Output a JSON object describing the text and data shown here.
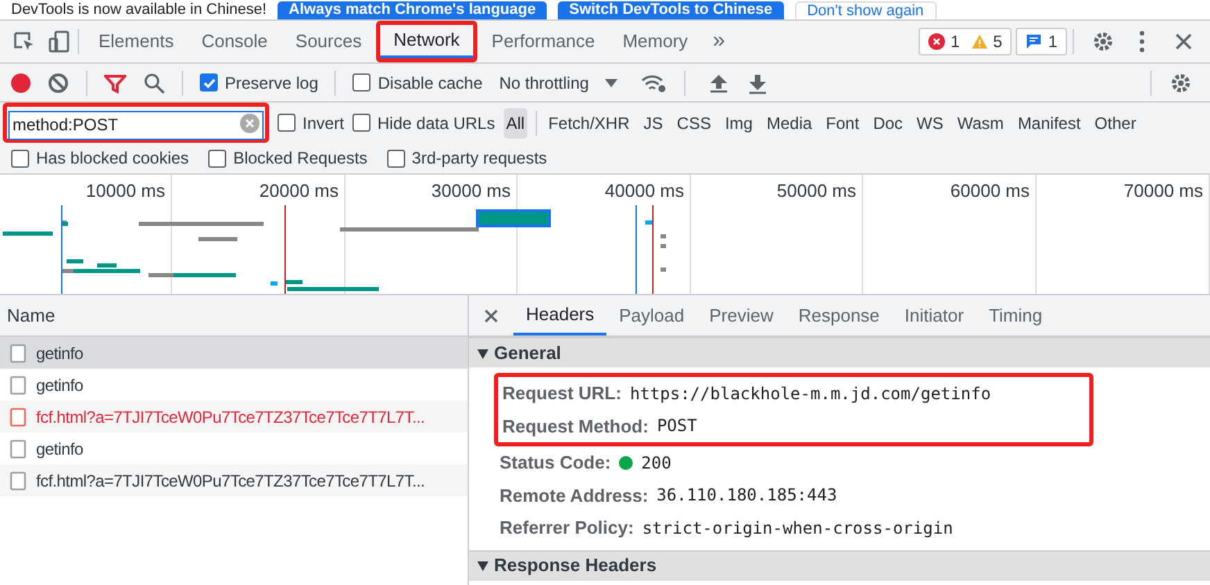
{
  "banner": {
    "text": "DevTools is now available in Chinese!",
    "buttons": [
      "Always match Chrome's language",
      "Switch DevTools to Chinese"
    ],
    "dismiss": "Don't show again"
  },
  "tabs": [
    {
      "label": "Elements",
      "selected": false,
      "highlighted": false
    },
    {
      "label": "Console",
      "selected": false,
      "highlighted": false
    },
    {
      "label": "Sources",
      "selected": false,
      "highlighted": false
    },
    {
      "label": "Network",
      "selected": true,
      "highlighted": true
    },
    {
      "label": "Performance",
      "selected": false,
      "highlighted": false
    },
    {
      "label": "Memory",
      "selected": false,
      "highlighted": false
    }
  ],
  "overflow": "»",
  "issues": {
    "errors": "1",
    "warnings": "5",
    "messages": "1"
  },
  "toolbar": {
    "recording": true,
    "preserve_log": {
      "label": "Preserve log",
      "checked": true
    },
    "disable_cache": {
      "label": "Disable cache",
      "checked": false
    },
    "throttling": "No throttling"
  },
  "filter": {
    "value": "method:POST",
    "highlighted": true,
    "invert": {
      "label": "Invert",
      "checked": false
    },
    "hide_data_urls": {
      "label": "Hide data URLs",
      "checked": false
    },
    "types": [
      {
        "label": "All",
        "selected": true
      },
      {
        "label": "Fetch/XHR",
        "selected": false
      },
      {
        "label": "JS",
        "selected": false
      },
      {
        "label": "CSS",
        "selected": false
      },
      {
        "label": "Img",
        "selected": false
      },
      {
        "label": "Media",
        "selected": false
      },
      {
        "label": "Font",
        "selected": false
      },
      {
        "label": "Doc",
        "selected": false
      },
      {
        "label": "WS",
        "selected": false
      },
      {
        "label": "Wasm",
        "selected": false
      },
      {
        "label": "Manifest",
        "selected": false
      },
      {
        "label": "Other",
        "selected": false
      }
    ]
  },
  "extra_filters": [
    {
      "label": "Has blocked cookies",
      "checked": false
    },
    {
      "label": "Blocked Requests",
      "checked": false
    },
    {
      "label": "3rd-party requests",
      "checked": false
    }
  ],
  "timeline": {
    "ticks": [
      "10000 ms",
      "20000 ms",
      "30000 ms",
      "40000 ms",
      "50000 ms",
      "60000 ms",
      "70000 ms"
    ]
  },
  "requests": {
    "column": "Name",
    "rows": [
      {
        "name": "getinfo",
        "selected": true,
        "failed": false
      },
      {
        "name": "getinfo",
        "selected": false,
        "failed": false
      },
      {
        "name": "fcf.html?a=7TJI7TceW0Pu7Tce7TZ37Tce7Tce7T7L7T...",
        "selected": false,
        "failed": true
      },
      {
        "name": "getinfo",
        "selected": false,
        "failed": false
      },
      {
        "name": "fcf.html?a=7TJI7TceW0Pu7Tce7TZ37Tce7Tce7T7L7T...",
        "selected": false,
        "failed": false
      }
    ]
  },
  "details": {
    "tabs": [
      {
        "label": "Headers",
        "selected": true
      },
      {
        "label": "Payload",
        "selected": false
      },
      {
        "label": "Preview",
        "selected": false
      },
      {
        "label": "Response",
        "selected": false
      },
      {
        "label": "Initiator",
        "selected": false
      },
      {
        "label": "Timing",
        "selected": false
      }
    ],
    "sections": [
      {
        "title": "General",
        "expanded": true,
        "fields": [
          {
            "kind": "plain",
            "label": "Request URL:",
            "value": "https://blackhole-m.m.jd.com/getinfo",
            "highlighted": true
          },
          {
            "kind": "plain",
            "label": "Request Method:",
            "value": "POST",
            "highlighted": true
          },
          {
            "kind": "status",
            "label": "Status Code:",
            "value": "200",
            "highlighted": false
          },
          {
            "kind": "plain",
            "label": "Remote Address:",
            "value": "36.110.180.185:443",
            "highlighted": false
          },
          {
            "kind": "plain",
            "label": "Referrer Policy:",
            "value": "strict-origin-when-cross-origin",
            "highlighted": false
          }
        ]
      },
      {
        "title": "Response Headers",
        "expanded": true
      }
    ]
  }
}
